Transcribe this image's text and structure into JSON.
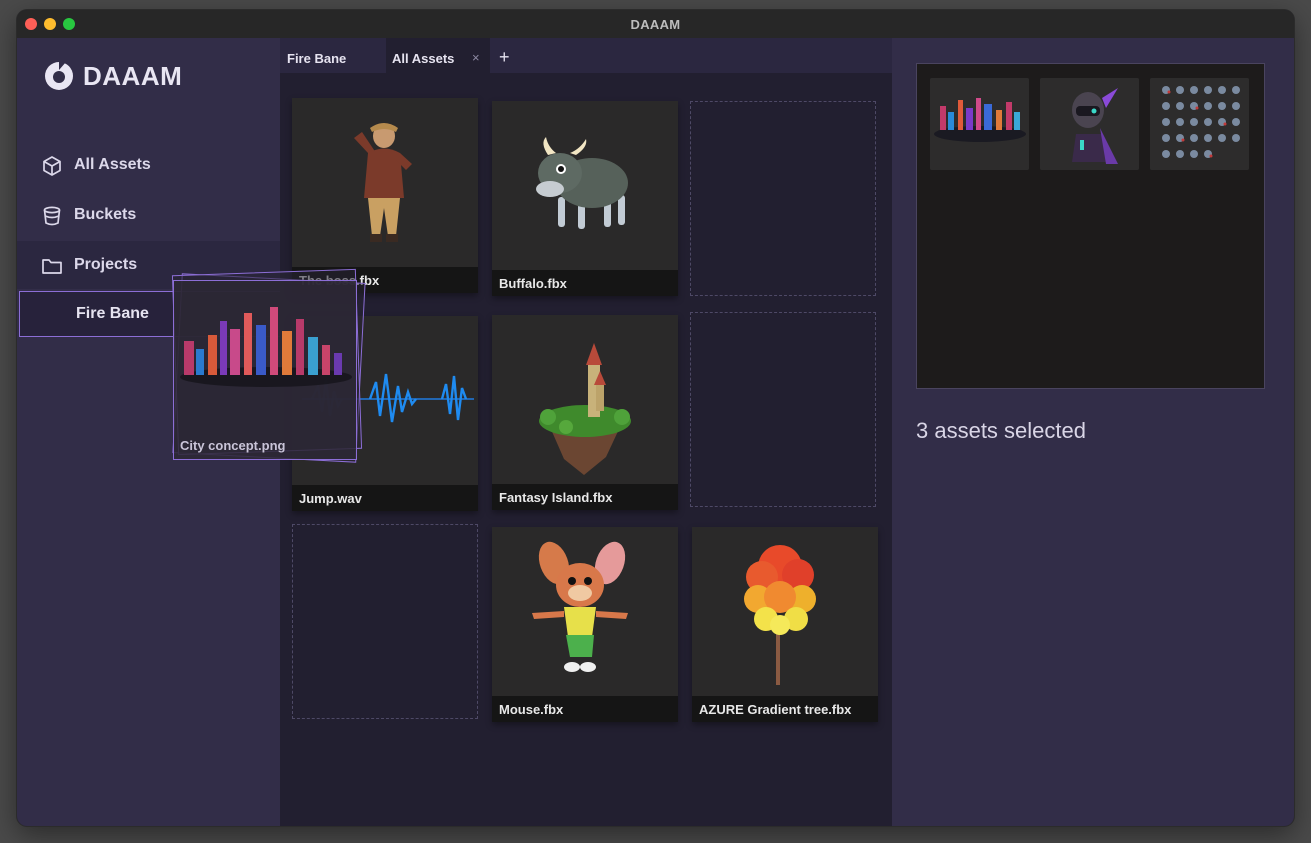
{
  "window": {
    "title": "DAAAM"
  },
  "sidebar": {
    "brand": "DAAAM",
    "items": [
      {
        "label": "All Assets",
        "icon": "cube-icon"
      },
      {
        "label": "Buckets",
        "icon": "bucket-icon"
      },
      {
        "label": "Projects",
        "icon": "folder-icon"
      }
    ],
    "sub_item": "Fire Bane"
  },
  "tabs": [
    {
      "label": "Fire Bane",
      "active": false
    },
    {
      "label": "All Assets",
      "active": true,
      "closable": true
    }
  ],
  "tab_add": "+",
  "tab_close": "×",
  "assets": [
    {
      "name": "The boss.fbx",
      "type": "model"
    },
    {
      "name": "Buffalo.fbx",
      "type": "model"
    },
    {
      "name": "Jump.wav",
      "type": "audio"
    },
    {
      "name": "Fantasy Island.fbx",
      "type": "model"
    },
    {
      "name": "Mouse.fbx",
      "type": "model"
    },
    {
      "name": "AZURE Gradient tree.fbx",
      "type": "model"
    }
  ],
  "drag": {
    "label": "City concept.png",
    "icon": "city-image"
  },
  "selection": {
    "count_text": "3 assets selected"
  },
  "colors": {
    "accent": "#8c6ed6",
    "sidebar_bg": "#322d48",
    "main_bg": "#221f30"
  }
}
